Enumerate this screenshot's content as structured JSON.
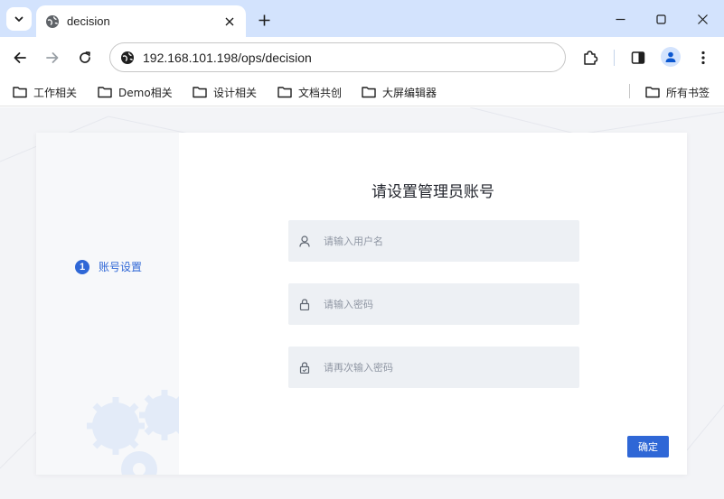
{
  "browser": {
    "tab": {
      "title": "decision",
      "favicon": "globe-icon",
      "close_icon": "close-icon"
    },
    "new_tab_icon": "plus-icon",
    "window_controls": [
      "minimize-icon",
      "maximize-icon",
      "close-icon"
    ],
    "address_bar": {
      "url": "192.168.101.198/ops/decision",
      "site_icon": "site-info-icon"
    },
    "toolbar_icons": [
      "back-icon",
      "forward-icon",
      "reload-icon",
      "extensions-icon",
      "side-panel-icon",
      "profile-icon",
      "menu-icon"
    ],
    "bookmarks": [
      {
        "label": "工作相关"
      },
      {
        "label": "Demo相关"
      },
      {
        "label": "设计相关"
      },
      {
        "label": "文档共创"
      },
      {
        "label": "大屏编辑器"
      }
    ],
    "all_bookmarks_label": "所有书签"
  },
  "page": {
    "step": {
      "number": "1",
      "label": "账号设置"
    },
    "title": "请设置管理员账号",
    "fields": [
      {
        "placeholder": "请输入用户名",
        "value": "",
        "icon": "user-icon"
      },
      {
        "placeholder": "请输入密码",
        "value": "",
        "icon": "lock-icon"
      },
      {
        "placeholder": "请再次输入密码",
        "value": "",
        "icon": "lock-check-icon"
      }
    ],
    "confirm_label": "确定"
  },
  "colors": {
    "accent": "#2f67d6",
    "titlebar": "#d3e3fd",
    "field_bg": "#edf0f4",
    "page_bg": "#f3f4f7"
  }
}
